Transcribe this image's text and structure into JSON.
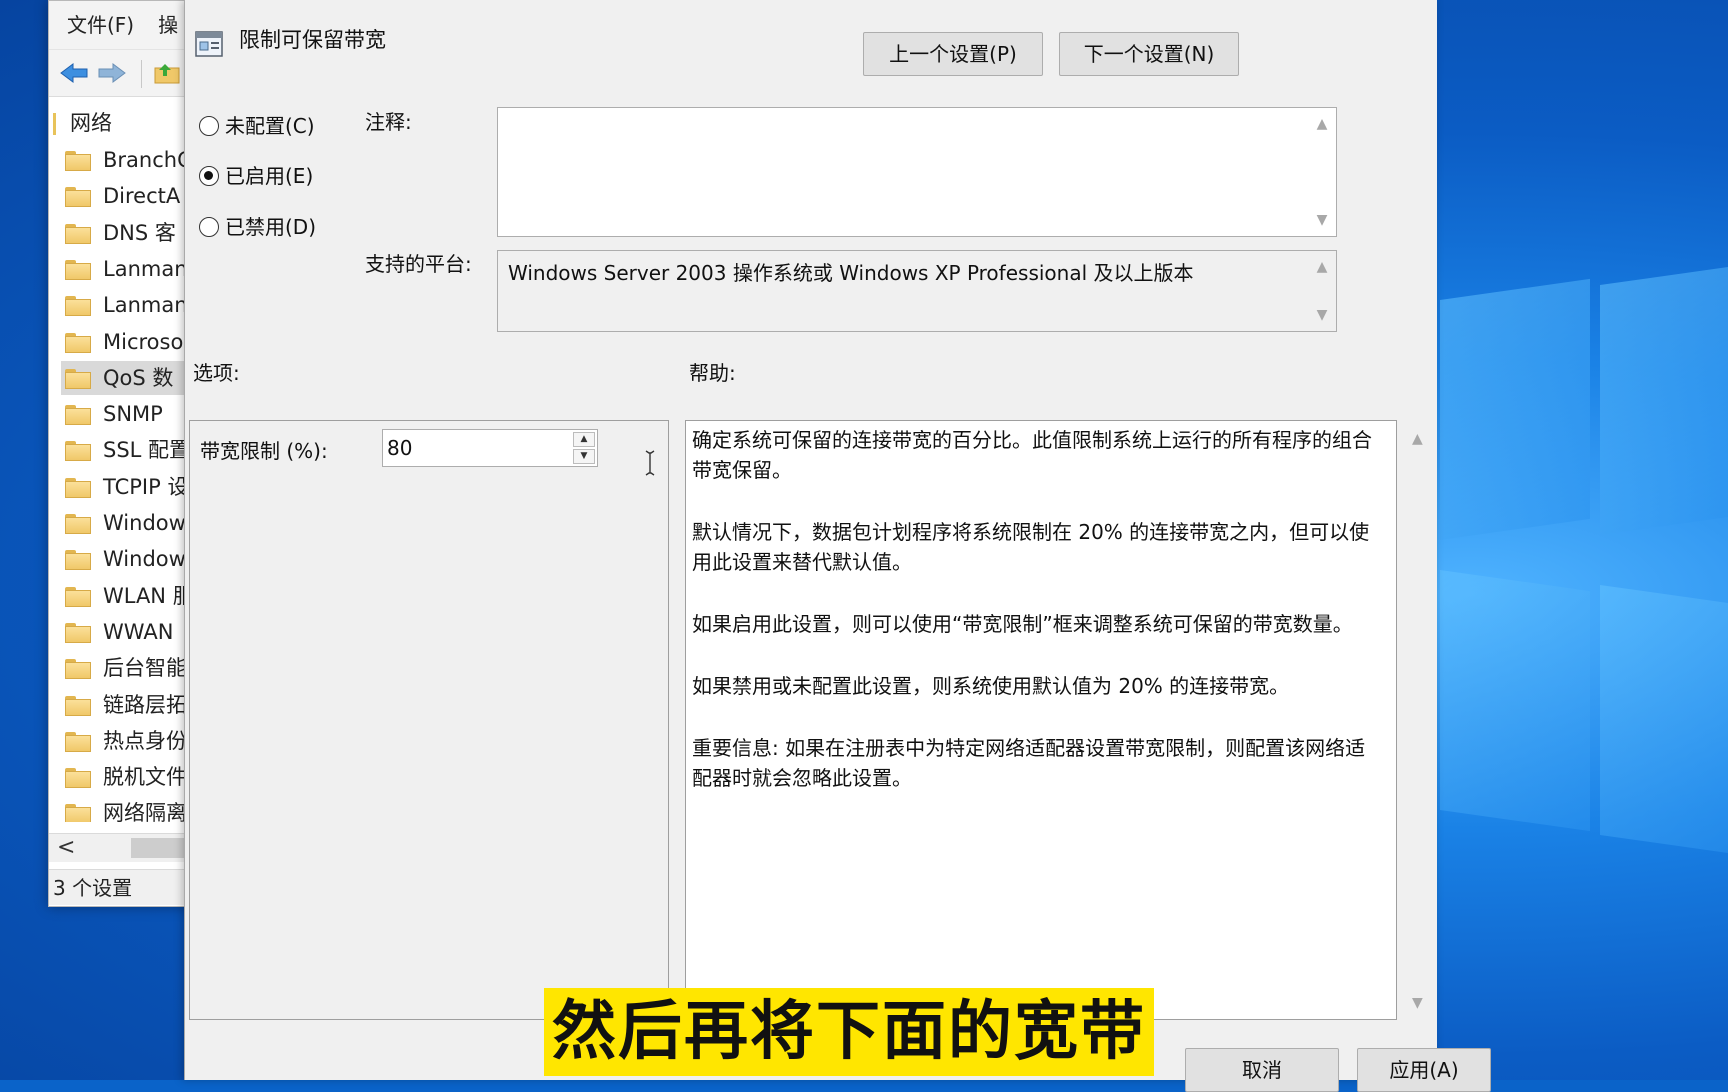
{
  "background_window": {
    "menu": [
      "文件(F)",
      "操"
    ],
    "tree_root": "网络",
    "tree_items": [
      "BranchC",
      "DirectA",
      "DNS 客",
      "Lanman",
      "Lanman",
      "Microso",
      "QoS 数",
      "SNMP",
      "SSL 配置",
      "TCPIP 设",
      "Window",
      "Window",
      "WLAN 服",
      "WWAN",
      "后台智能",
      "链路层拓",
      "热点身份",
      "脱机文件",
      "网络隔离"
    ],
    "selected_index": 6,
    "status": "3 个设置",
    "scroll_left": "<"
  },
  "dialog": {
    "title": "限制可保留带宽",
    "prev_button": "上一个设置(P)",
    "next_button": "下一个设置(N)",
    "radios": [
      {
        "label": "未配置(C)",
        "checked": false
      },
      {
        "label": "已启用(E)",
        "checked": true
      },
      {
        "label": "已禁用(D)",
        "checked": false
      }
    ],
    "comment_label": "注释:",
    "comment_value": "",
    "platform_label": "支持的平台:",
    "platform_value": "Windows Server 2003 操作系统或 Windows XP Professional 及以上版本",
    "options_label": "选项:",
    "help_label": "帮助:",
    "bandwidth_label": "带宽限制 (%):",
    "bandwidth_value": "80",
    "help_paragraphs": [
      "确定系统可保留的连接带宽的百分比。此值限制系统上运行的所有程序的组合带宽保留。",
      "默认情况下，数据包计划程序将系统限制在 20% 的连接带宽之内，但可以使用此设置来替代默认值。",
      "如果启用此设置，则可以使用“带宽限制”框来调整系统可保留的带宽数量。",
      "如果禁用或未配置此设置，则系统使用默认值为 20% 的连接带宽。",
      "重要信息: 如果在注册表中为特定网络适配器设置带宽限制，则配置该网络适配器时就会忽略此设置。"
    ],
    "cancel_button": "取消",
    "apply_button": "应用(A)"
  },
  "caption": "然后再将下面的宽带"
}
